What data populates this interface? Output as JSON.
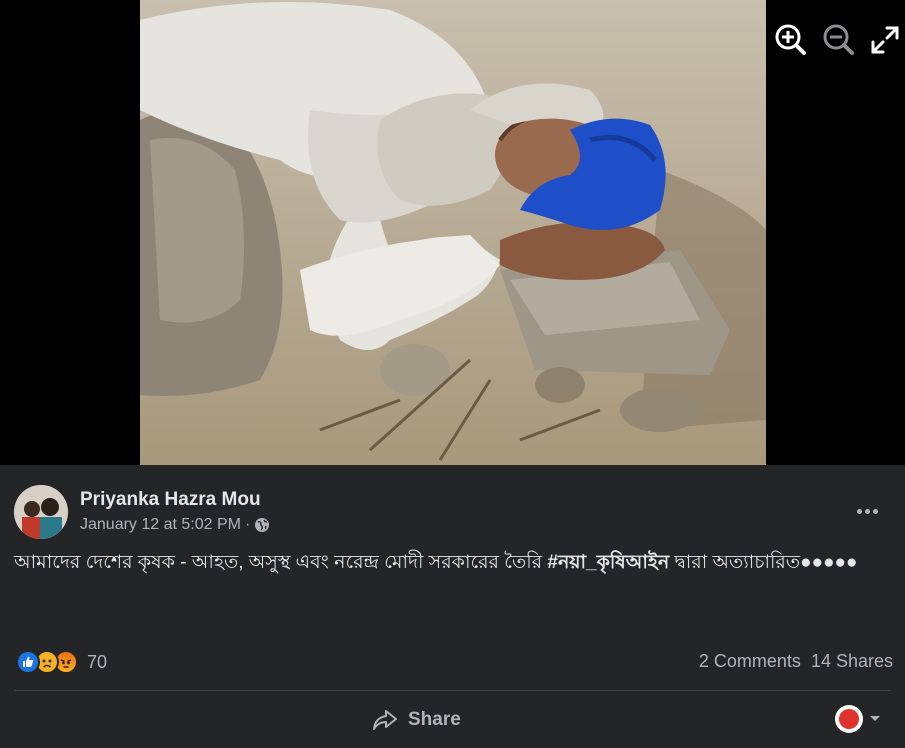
{
  "viewer": {
    "tools": [
      {
        "name": "zoom-in",
        "icon": "zoom-in-icon"
      },
      {
        "name": "zoom-out",
        "icon": "zoom-out-icon"
      },
      {
        "name": "fullscreen",
        "icon": "expand-icon"
      }
    ]
  },
  "post": {
    "author": "Priyanka Hazra Mou",
    "date": "January 12 at 5:02 PM",
    "separator": "·",
    "privacy_icon": "globe-icon",
    "caption_text": "আমাদের দেশের কৃষক - আহত, অসুস্থ এবং নরেন্দ্র মোদী সরকারের তৈরি ",
    "hashtag": "#নয়া_কৃষিআইন",
    "caption_tail": " দ্বারা অত্যাচারিত●●●●●",
    "reactions": {
      "types": [
        "like",
        "sad",
        "angry"
      ],
      "count": "70"
    },
    "comments": "2 Comments",
    "shares": "14 Shares",
    "share_label": "Share"
  },
  "colors": {
    "panel_bg": "#242526",
    "text_primary": "#e4e6eb",
    "text_secondary": "#b0b3b8",
    "like_blue": "#1b74e4",
    "turban_blue": "#1f4fc8"
  }
}
